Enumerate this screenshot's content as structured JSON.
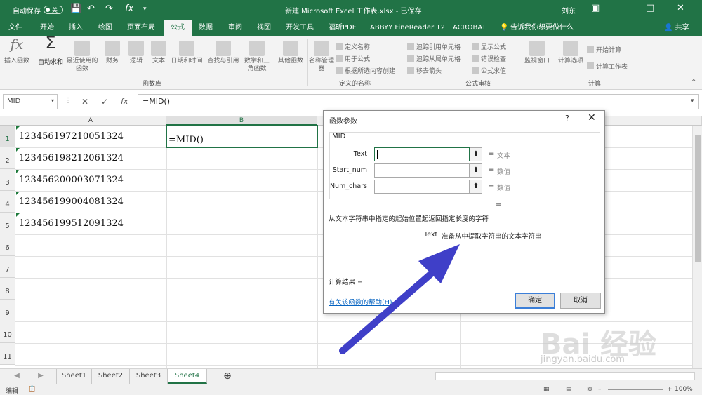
{
  "titlebar": {
    "autosave_label": "自动保存",
    "autosave_state": "关",
    "file_title": "新建 Microsoft Excel 工作表.xlsx  -  已保存",
    "user": "刘东"
  },
  "tabs": [
    "文件",
    "开始",
    "插入",
    "绘图",
    "页面布局",
    "公式",
    "数据",
    "审阅",
    "视图",
    "开发工具",
    "福昕PDF",
    "ABBYY FineReader 12",
    "ACROBAT"
  ],
  "active_tab": "公式",
  "tell_me": "告诉我你想要做什么",
  "share": "共享",
  "ribbon": {
    "insert_function": "插入函数",
    "autosum": "自动求和",
    "recent": "最近使用的函数",
    "financial": "财务",
    "logical": "逻辑",
    "text": "文本",
    "datetime": "日期和时间",
    "lookup": "查找与引用",
    "math": "数学和三角函数",
    "more": "其他函数",
    "group_library": "函数库",
    "name_manager": "名称管理器",
    "define_name": "定义名称",
    "use_in_formula": "用于公式",
    "create_from_selection": "根据所选内容创建",
    "group_names": "定义的名称",
    "trace_precedents": "追踪引用单元格",
    "trace_dependents": "追踪从属单元格",
    "remove_arrows": "移去箭头",
    "show_formulas": "显示公式",
    "error_checking": "错误检查",
    "evaluate_formula": "公式求值",
    "watch_window": "监视窗口",
    "group_auditing": "公式审核",
    "calc_options": "计算选项",
    "calc_now": "开始计算",
    "calc_sheet": "计算工作表",
    "group_calc": "计算"
  },
  "formula_bar": {
    "name_box": "MID",
    "formula": "=MID()"
  },
  "columns": [
    "A",
    "B"
  ],
  "rows": [
    "1",
    "2",
    "3",
    "4",
    "5",
    "6",
    "7",
    "8",
    "9",
    "10",
    "11"
  ],
  "cells_a": [
    "123456197210051324",
    "123456198212061324",
    "123456200003071324",
    "123456199004081324",
    "123456199512091324"
  ],
  "cell_b1": "=MID()",
  "dialog": {
    "title": "函数参数",
    "help_q": "?",
    "func_name": "MID",
    "args": [
      {
        "label": "Text",
        "result": "文本"
      },
      {
        "label": "Start_num",
        "result": "数值"
      },
      {
        "label": "Num_chars",
        "result": "数值"
      }
    ],
    "eq": "=",
    "description": "从文本字符串中指定的起始位置起返回指定长度的字符",
    "arg_help_name": "Text",
    "arg_help_text": "准备从中提取字符串的文本字符串",
    "calc_result": "计算结果 =",
    "help_link": "有关该函数的帮助(H)",
    "ok": "确定",
    "cancel": "取消"
  },
  "sheets": [
    "Sheet1",
    "Sheet2",
    "Sheet3",
    "Sheet4"
  ],
  "active_sheet": "Sheet4",
  "status": {
    "mode": "编辑",
    "zoom": "100%"
  },
  "watermark": {
    "brand": "Bai 经验",
    "url": "jingyan.baidu.com"
  },
  "colors": {
    "excel_green": "#217346",
    "arrow": "#3f3fc8"
  }
}
